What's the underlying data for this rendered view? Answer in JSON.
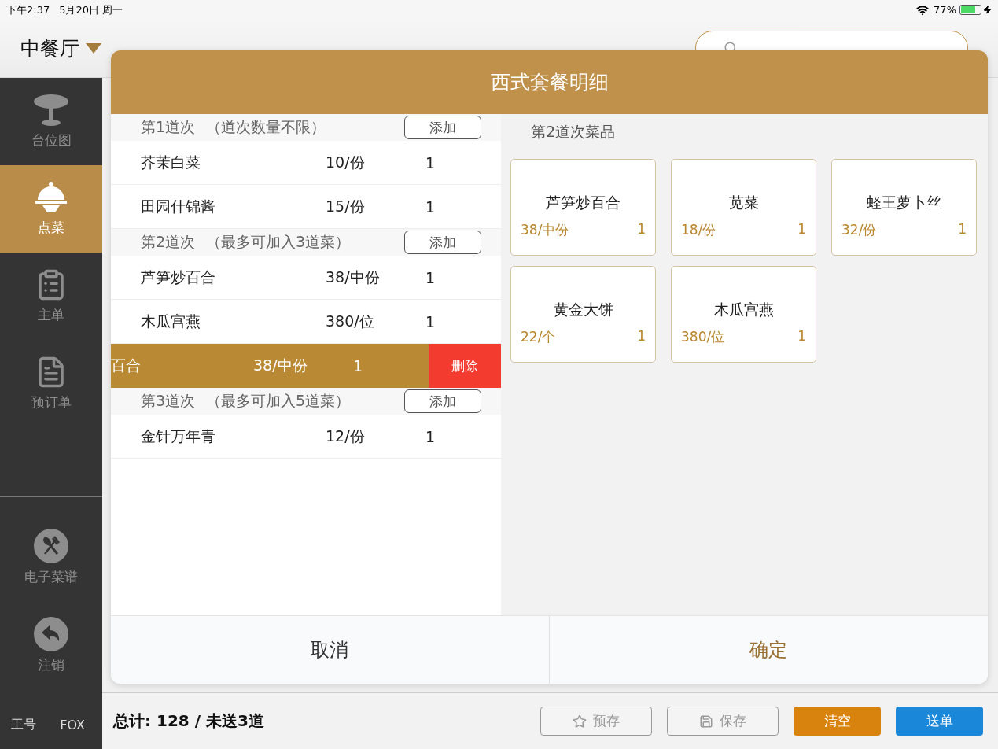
{
  "status_bar": {
    "time": "下午2:37",
    "date": "5月20日 周一",
    "battery": "77%"
  },
  "header": {
    "venue": "中餐厅"
  },
  "sidebar": {
    "items": [
      {
        "label": "台位图",
        "kind": "table",
        "selected": false
      },
      {
        "label": "点菜",
        "kind": "cloche",
        "selected": true
      },
      {
        "label": "主单",
        "kind": "clipboard",
        "selected": false
      },
      {
        "label": "预订单",
        "kind": "document",
        "selected": false
      }
    ],
    "lower_items": [
      {
        "label": "电子菜谱",
        "kind": "menu"
      },
      {
        "label": "注销",
        "kind": "logout"
      }
    ],
    "staff_label": "工号",
    "staff_name": "FOX"
  },
  "modal": {
    "title": "西式套餐明细",
    "courses": [
      {
        "title": "第1道次",
        "note": "（道次数量不限）",
        "add_label": "添加",
        "dishes": [
          {
            "kind": "normal",
            "name": "芥茉白菜",
            "price": "10/份",
            "qty": "1"
          },
          {
            "kind": "normal",
            "name": "田园什锦酱",
            "price": "15/份",
            "qty": "1"
          }
        ]
      },
      {
        "title": "第2道次",
        "note": "（最多可加入3道菜）",
        "add_label": "添加",
        "dishes": [
          {
            "kind": "normal",
            "name": "芦笋炒百合",
            "price": "38/中份",
            "qty": "1"
          },
          {
            "kind": "normal",
            "name": "木瓜宫燕",
            "price": "380/位",
            "qty": "1"
          },
          {
            "kind": "swiped",
            "name": "百合",
            "price": "38/中份",
            "qty": "1",
            "delete_label": "删除"
          }
        ]
      },
      {
        "title": "第3道次",
        "note": "（最多可加入5道菜）",
        "add_label": "添加",
        "dishes": [
          {
            "kind": "normal",
            "name": "金针万年青",
            "price": "12/份",
            "qty": "1"
          }
        ]
      }
    ],
    "picker_title": "第2道次菜品",
    "picker_items": [
      {
        "name": "芦笋炒百合",
        "price": "38/中份",
        "qty": "1"
      },
      {
        "name": "苋菜",
        "price": "18/份",
        "qty": "1"
      },
      {
        "name": "蛏王萝卜丝",
        "price": "32/份",
        "qty": "1"
      },
      {
        "name": "黄金大饼",
        "price": "22/个",
        "qty": "1"
      },
      {
        "name": "木瓜宫燕",
        "price": "380/位",
        "qty": "1"
      }
    ],
    "cancel_label": "取消",
    "confirm_label": "确定"
  },
  "footer": {
    "total": "总计: 128 / 未送3道",
    "buttons": [
      {
        "label": "预存",
        "kind": "draft"
      },
      {
        "label": "保存",
        "kind": "save"
      },
      {
        "label": "清空",
        "kind": "clear"
      },
      {
        "label": "送单",
        "kind": "send"
      }
    ]
  }
}
